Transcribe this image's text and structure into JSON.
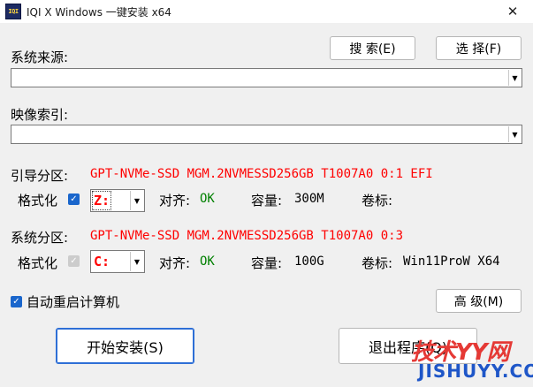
{
  "window": {
    "icon_text": "IQI",
    "title": "IQI X Windows 一键安装 x64",
    "close_glyph": "✕"
  },
  "source": {
    "label": "系统来源:",
    "value": "",
    "search_button": "搜 索(E)",
    "select_button": "选 择(F)"
  },
  "image_index": {
    "label": "映像索引:",
    "value": ""
  },
  "boot_partition": {
    "label": "引导分区:",
    "value": "GPT-NVMe-SSD MGM.2NVMESSD256GB T1007A0 0:1 EFI",
    "format_label": "格式化",
    "format_checked": true,
    "drive": "Z:",
    "align_label": "对齐:",
    "align_value": "OK",
    "capacity_label": "容量:",
    "capacity_value": "300M",
    "volume_label": "卷标:",
    "volume_value": ""
  },
  "system_partition": {
    "label": "系统分区:",
    "value": "GPT-NVMe-SSD MGM.2NVMESSD256GB T1007A0 0:3",
    "format_label": "格式化",
    "format_checked": true,
    "format_disabled": true,
    "drive": "C:",
    "align_label": "对齐:",
    "align_value": "OK",
    "capacity_label": "容量:",
    "capacity_value": "100G",
    "volume_label": "卷标:",
    "volume_value": "Win11ProW X64"
  },
  "options": {
    "auto_restart_label": "自动重启计算机",
    "auto_restart_checked": true,
    "advanced_button": "高 级(M)"
  },
  "actions": {
    "start_button": "开始安装(S)",
    "exit_button": "退出程序(Q)"
  },
  "watermark": {
    "top": "技术YY网",
    "bottom": "JISHUYY.COM"
  },
  "colors": {
    "partition_text": "#ff0000",
    "ok_text": "#008000",
    "checkbox": "#1a66cc",
    "window_bg": "#f0f0f0"
  }
}
